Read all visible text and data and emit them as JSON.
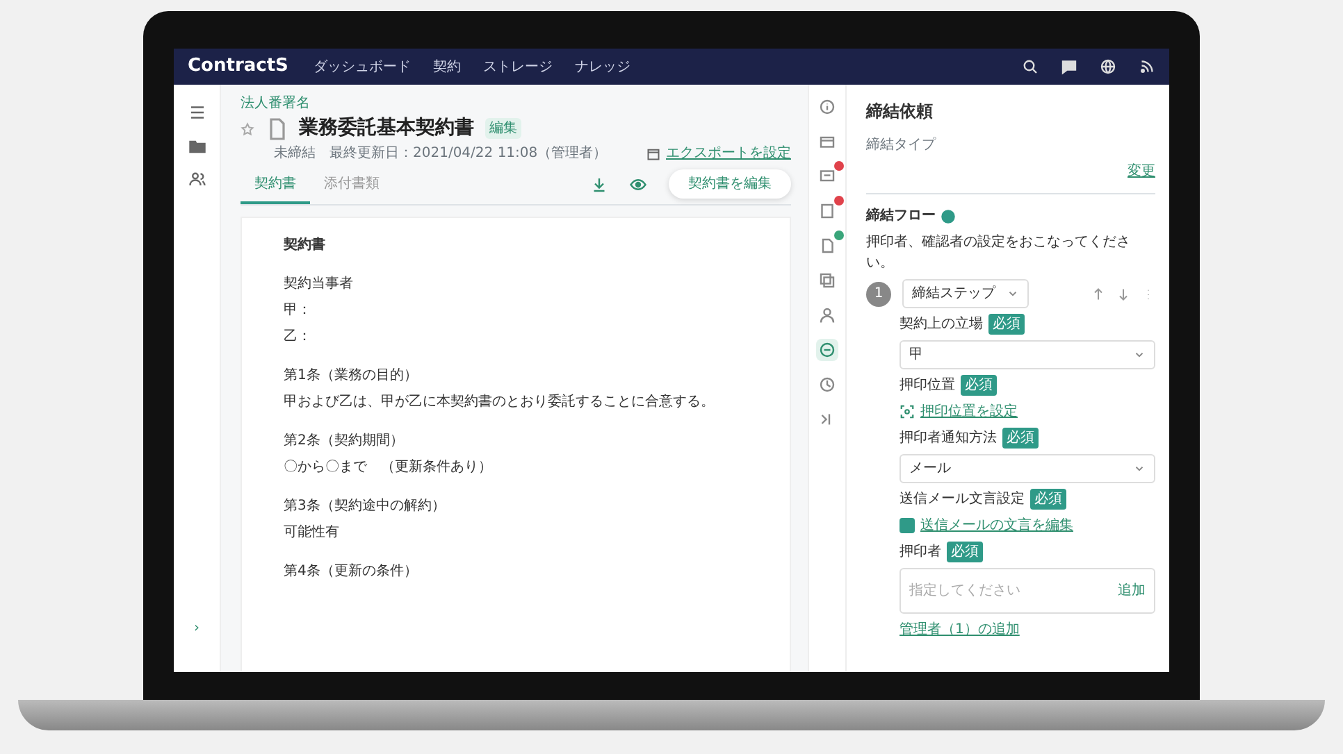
{
  "navbar": {
    "brand": "ContractS",
    "links": [
      "ダッシュボード",
      "契約",
      "ストレージ",
      "ナレッジ"
    ]
  },
  "left_rail": {
    "collapse": "›"
  },
  "header": {
    "breadcrumb": "法人番署名",
    "title": "業務委託基本契約書",
    "tag": "編集",
    "meta": "未締結　最終更新日：2021/04/22 11:08（管理者）",
    "export_link": "エクスポートを設定",
    "tabs": [
      {
        "label": "契約書",
        "selected": true
      },
      {
        "label": "添付書類",
        "selected": false
      }
    ],
    "edit_button": "契約書を編集"
  },
  "document": {
    "lines": [
      {
        "kind": "heading",
        "text": "契約書"
      },
      {
        "kind": "gap"
      },
      {
        "kind": "text",
        "text": "契約当事者"
      },
      {
        "kind": "text",
        "text": "甲："
      },
      {
        "kind": "text",
        "text": "乙："
      },
      {
        "kind": "gap"
      },
      {
        "kind": "text",
        "text": "第1条（業務の目的）"
      },
      {
        "kind": "text",
        "text": "甲および乙は、甲が乙に本契約書のとおり委託することに合意する。"
      },
      {
        "kind": "gap"
      },
      {
        "kind": "text",
        "text": "第2条（契約期間）"
      },
      {
        "kind": "text",
        "text": "〇から〇まで　（更新条件あり）"
      },
      {
        "kind": "gap"
      },
      {
        "kind": "text",
        "text": "第3条（契約途中の解約）"
      },
      {
        "kind": "text",
        "text": "可能性有"
      },
      {
        "kind": "gap"
      },
      {
        "kind": "text",
        "text": "第4条（更新の条件）"
      }
    ]
  },
  "icon_rail": [
    {
      "selected": false
    },
    {
      "selected": false
    },
    {
      "selected": false,
      "color": "#e0424b"
    },
    {
      "selected": false,
      "color": "#e0424b"
    },
    {
      "selected": false,
      "color": "#3aa57a"
    },
    {
      "selected": false
    },
    {
      "selected": false
    },
    {
      "selected": true
    },
    {
      "selected": false
    },
    {
      "selected": false
    }
  ],
  "panel": {
    "title": "締結依頼",
    "type_label": "締結タイプ",
    "type_change": "変更",
    "flow_title": "締結フロー",
    "flow_desc": "押印者、確認者の設定をおこなってください。",
    "step_number": "1",
    "step_select": "締結ステップ",
    "fields": [
      {
        "kind": "select",
        "label": "契約上の立場",
        "required": "必須",
        "value": "甲"
      },
      {
        "kind": "link",
        "label": "押印位置",
        "required": "必須",
        "value": "押印位置を設定"
      },
      {
        "kind": "select",
        "label": "押印者通知方法",
        "required": "必須",
        "value": "メール"
      },
      {
        "kind": "check",
        "label": "送信メール文言設定",
        "required": "必須",
        "value": "送信メールの文言を編集",
        "checked": true
      },
      {
        "kind": "input",
        "label": "押印者",
        "required": "必須",
        "placeholder": "指定してください",
        "action": "追加"
      }
    ],
    "footer_link": "管理者（1）の追加"
  }
}
